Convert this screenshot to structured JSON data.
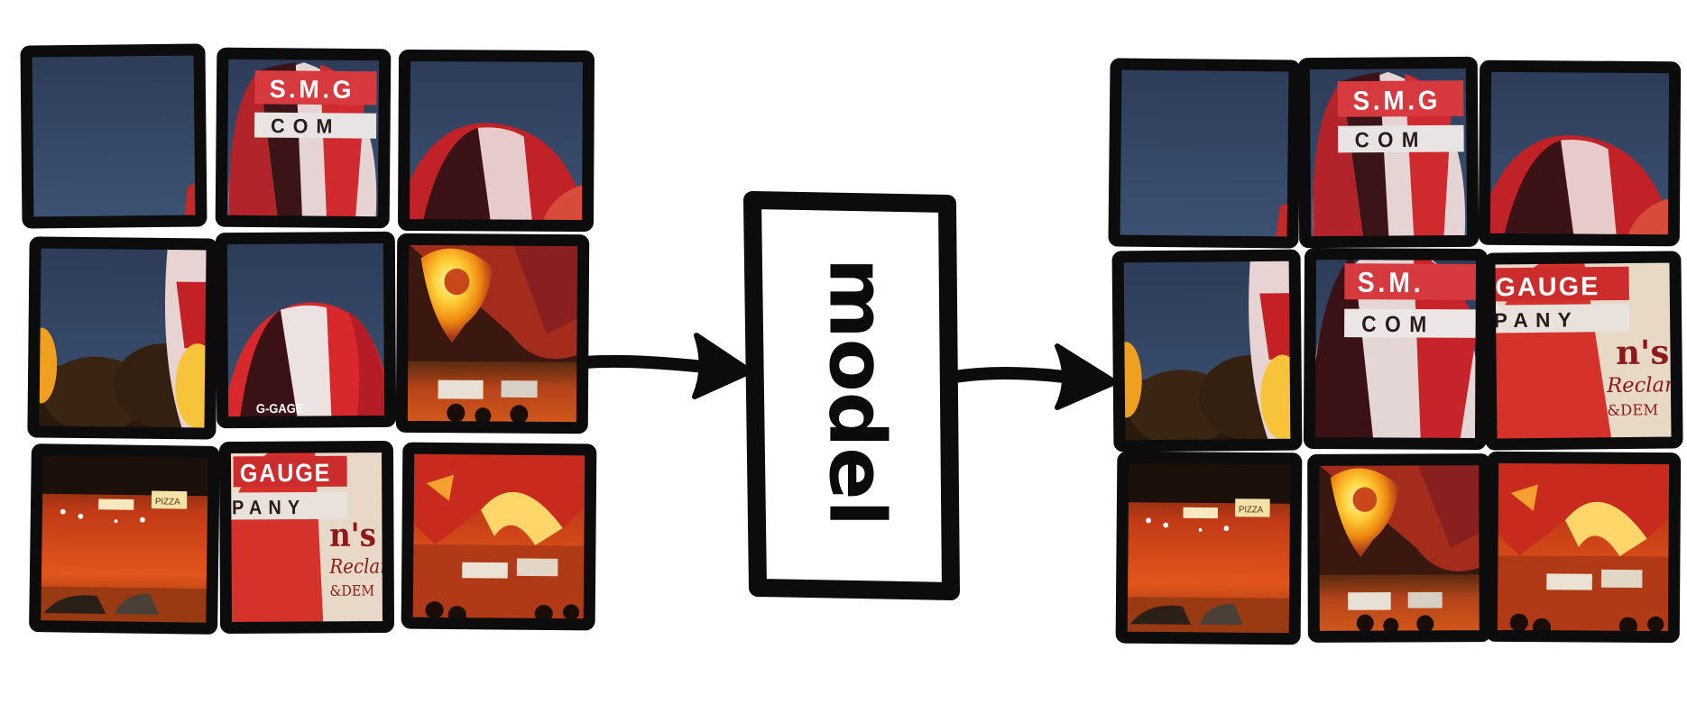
{
  "diagram": {
    "model_label": "model",
    "tile_border_color": "#0c0c0c",
    "arrow_color": "#0c0c0c",
    "input_grid": {
      "label": "",
      "tiles": [
        {
          "name": "input-tile-1-sky",
          "content": "sky"
        },
        {
          "name": "input-tile-2-balloon-top-center",
          "content": "balloon-top-center",
          "text": "S.M.G\nCOM"
        },
        {
          "name": "input-tile-3-balloon-top-right",
          "content": "balloon-top-right"
        },
        {
          "name": "input-tile-4-balloon-left-edge",
          "content": "balloon-left-edge"
        },
        {
          "name": "input-tile-5-balloon-lower-left",
          "content": "balloon-lower-left",
          "text": "G-GAGE"
        },
        {
          "name": "input-tile-6-glowing-balloon",
          "content": "glowing-balloon"
        },
        {
          "name": "input-tile-7-crowd-left",
          "content": "crowd-left"
        },
        {
          "name": "input-tile-8-balloon-company",
          "content": "balloon-company",
          "text": "GAUGE\nPANY"
        },
        {
          "name": "input-tile-9-crowd-right",
          "content": "crowd-right"
        }
      ]
    },
    "output_grid": {
      "label": "",
      "tiles": [
        {
          "name": "output-tile-1-sky",
          "content": "sky"
        },
        {
          "name": "output-tile-2-balloon-top-center",
          "content": "balloon-top-center"
        },
        {
          "name": "output-tile-3-balloon-top-right",
          "content": "balloon-top-right"
        },
        {
          "name": "output-tile-4-balloon-left-edge",
          "content": "balloon-left-edge"
        },
        {
          "name": "output-tile-5-balloon-center",
          "content": "balloon-center",
          "text": "S.M.\nCOM"
        },
        {
          "name": "output-tile-6-balloon-right",
          "content": "balloon-right",
          "text": "GAUGE\nPANY"
        },
        {
          "name": "output-tile-7-crowd-left",
          "content": "crowd-left"
        },
        {
          "name": "output-tile-8-glowing-balloon",
          "content": "glowing-balloon"
        },
        {
          "name": "output-tile-9-crowd-right",
          "content": "crowd-right"
        }
      ]
    }
  }
}
